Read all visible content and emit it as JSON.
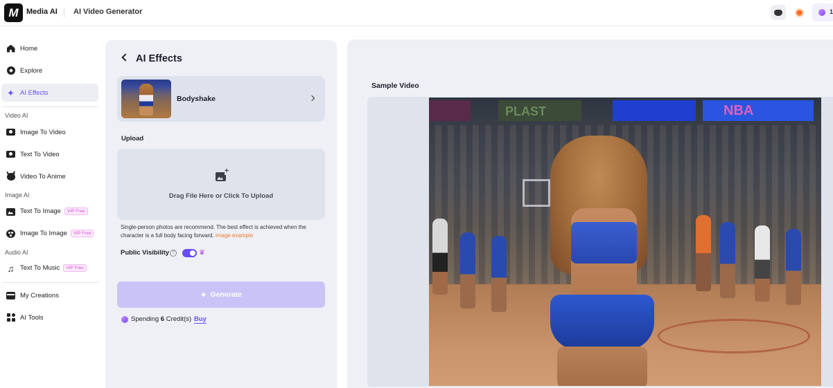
{
  "header": {
    "logo_text": "M",
    "brand": "Media AI",
    "page": "AI Video Generator",
    "credits_count": "1",
    "icons": [
      "discord-icon",
      "sun-icon",
      "coin-icon"
    ]
  },
  "sidebar": {
    "items": [
      {
        "label": "Home",
        "icon": "home-icon"
      },
      {
        "label": "Explore",
        "icon": "compass-icon"
      },
      {
        "label": "AI Effects",
        "icon": "sparkle-icon",
        "active": true
      }
    ],
    "sections": [
      {
        "title": "Video AI",
        "items": [
          {
            "label": "Image To Video",
            "icon": "camera-icon"
          },
          {
            "label": "Text To Video",
            "icon": "camera-text-icon"
          },
          {
            "label": "Video To Anime",
            "icon": "anime-icon"
          }
        ]
      },
      {
        "title": "Image AI",
        "items": [
          {
            "label": "Text To Image",
            "icon": "image-icon",
            "badge": "VIP Free"
          },
          {
            "label": "Image To Image",
            "icon": "palette-icon",
            "badge": "VIP Free"
          }
        ]
      },
      {
        "title": "Audio AI",
        "items": [
          {
            "label": "Text To Music",
            "icon": "music-icon",
            "badge": "VIP Free"
          }
        ]
      }
    ],
    "bottom_items": [
      {
        "label": "My Creations",
        "icon": "folder-icon"
      },
      {
        "label": "AI Tools",
        "icon": "grid-icon"
      }
    ]
  },
  "effects_panel": {
    "title": "AI Effects",
    "effect": {
      "name": "Bodyshake"
    },
    "upload": {
      "label": "Upload",
      "drop_text": "Drag File Here or Click To Upload"
    },
    "hint": "Single-person photos are recommend. The best effect is achieved when the character is a full body facing forward.",
    "hint_link": "image example",
    "visibility": {
      "label": "Public Visibility",
      "help": "?",
      "enabled": true
    },
    "generate_label": "Generate",
    "spending": {
      "prefix": "Spending",
      "amount": "6",
      "suffix": "Credit(s)",
      "buy": "Buy"
    }
  },
  "preview": {
    "label": "Sample Video",
    "banner_texts": [
      "PLAST",
      "NBA"
    ]
  },
  "colors": {
    "accent": "#6a4cf5",
    "panel_bg": "#eef0f5",
    "generate_disabled": "#c9c3f7",
    "vip_badge": "#d44bd3",
    "link_orange": "#f07a2a"
  }
}
